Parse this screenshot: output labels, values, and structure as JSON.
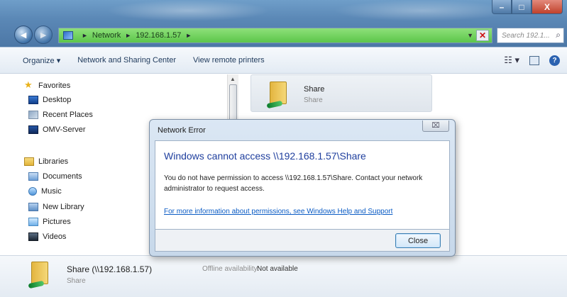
{
  "window": {
    "minimize_glyph": "–",
    "maximize_glyph": "□",
    "close_glyph": "X"
  },
  "nav": {
    "back_glyph": "◄",
    "forward_glyph": "►"
  },
  "address": {
    "segments": [
      "Network",
      "192.168.1.57"
    ],
    "separator": "►",
    "error_glyph": "✕"
  },
  "search": {
    "placeholder": "Search 192.1...",
    "icon_glyph": "⌕"
  },
  "toolbar": {
    "organize": "Organize ▾",
    "network_center": "Network and Sharing Center",
    "view_printers": "View remote printers",
    "views_glyph": "☷ ▾",
    "help_glyph": "?"
  },
  "sidebar": {
    "favorites": "Favorites",
    "desktop": "Desktop",
    "recent": "Recent Places",
    "server": "OMV-Server",
    "libraries": "Libraries",
    "documents": "Documents",
    "music": "Music",
    "new_library": "New Library",
    "pictures": "Pictures",
    "videos": "Videos"
  },
  "content": {
    "tile_name": "Share",
    "tile_sub": "Share"
  },
  "details": {
    "name": "Share (\\\\192.168.1.57)",
    "offline_label": "Offline availability:",
    "offline_value": "Not available",
    "sub": "Share"
  },
  "dialog": {
    "title": "Network Error",
    "close_glyph": "⌧",
    "heading": "Windows cannot access \\\\192.168.1.57\\Share",
    "message": "You do not have permission to access \\\\192.168.1.57\\Share. Contact your network administrator to request access.",
    "link": "For more information about permissions, see Windows Help and Support",
    "button": "Close"
  },
  "colors": {
    "address_bar": "#5cc64a",
    "dialog_heading": "#1f3f9e",
    "link": "#0a5bc4"
  }
}
